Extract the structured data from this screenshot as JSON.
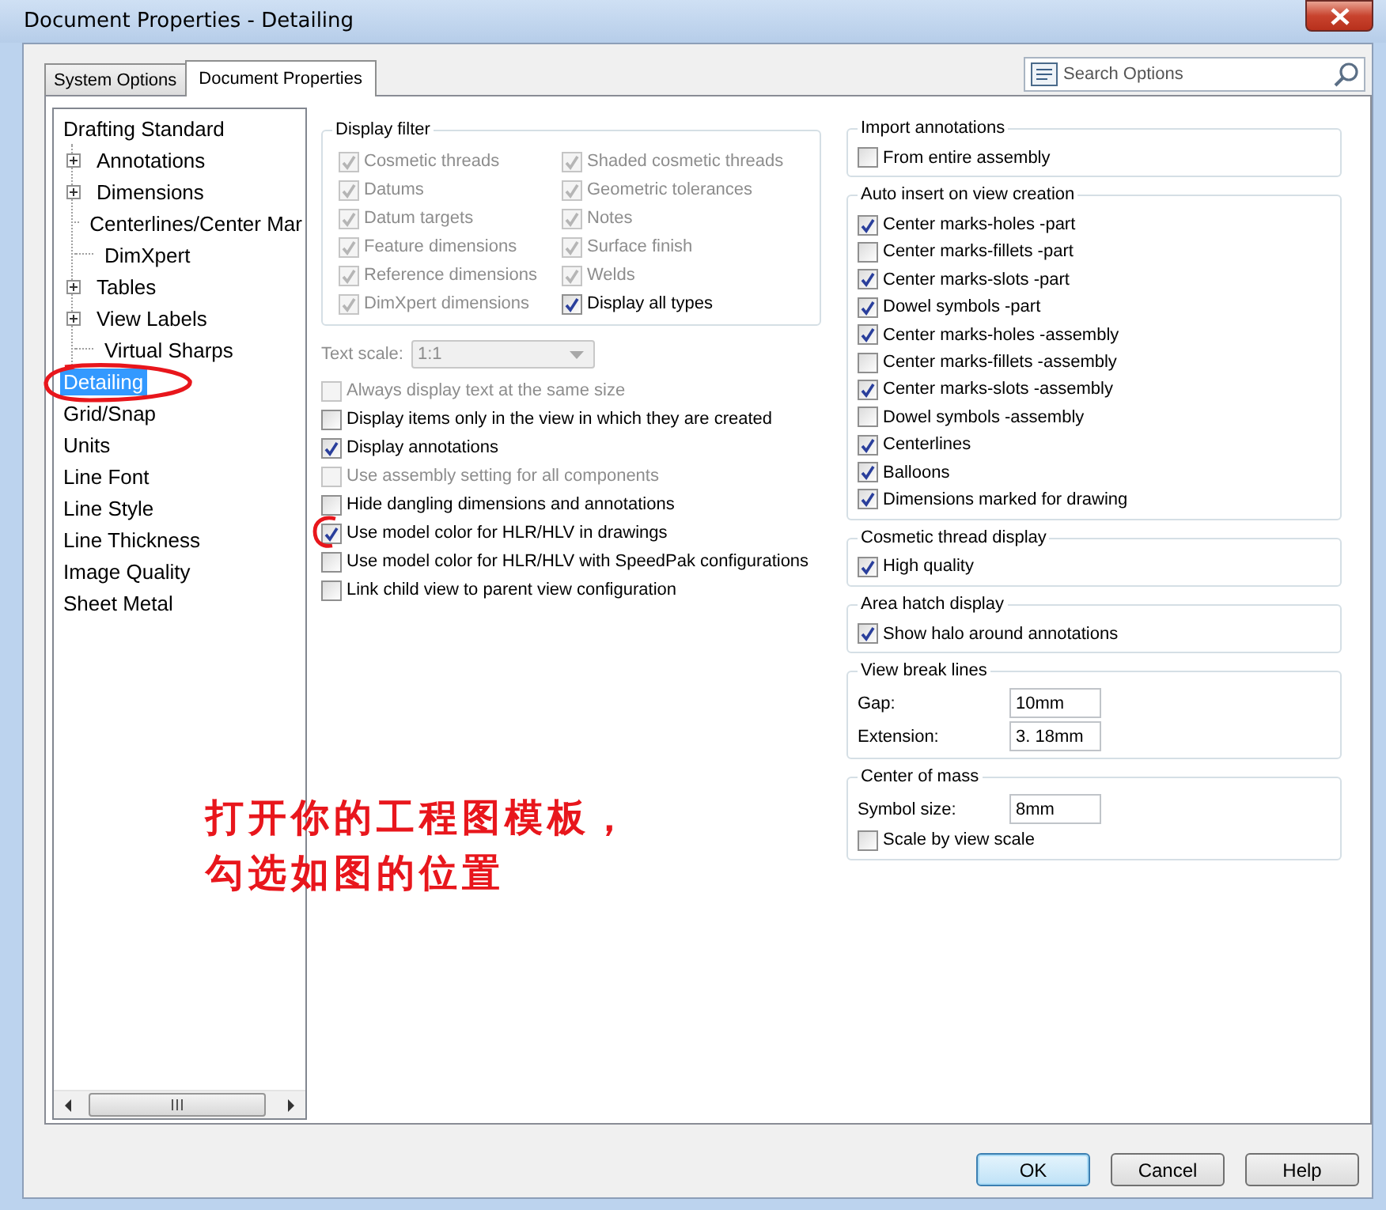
{
  "window": {
    "title": "Document Properties - Detailing"
  },
  "tabs": [
    {
      "label": "System Options",
      "selected": false
    },
    {
      "label": "Document Properties",
      "selected": true
    }
  ],
  "search": {
    "placeholder": "Search Options"
  },
  "tree": [
    {
      "label": "Drafting Standard",
      "selected": false,
      "children": [
        {
          "label": "Annotations",
          "selected": false,
          "kind": "collapsed"
        },
        {
          "label": "Dimensions",
          "selected": false,
          "kind": "collapsed"
        },
        {
          "label": "Centerlines/Center Mar",
          "selected": false,
          "kind": "leaf"
        },
        {
          "label": "DimXpert",
          "selected": false,
          "kind": "leaf"
        },
        {
          "label": "Tables",
          "selected": false,
          "kind": "collapsed"
        },
        {
          "label": "View Labels",
          "selected": false,
          "kind": "collapsed"
        },
        {
          "label": "Virtual Sharps",
          "selected": false,
          "kind": "leaf"
        }
      ]
    },
    {
      "label": "Detailing",
      "selected": true
    },
    {
      "label": "Grid/Snap",
      "selected": false
    },
    {
      "label": "Units",
      "selected": false
    },
    {
      "label": "Line Font",
      "selected": false
    },
    {
      "label": "Line Style",
      "selected": false
    },
    {
      "label": "Line Thickness",
      "selected": false
    },
    {
      "label": "Image Quality",
      "selected": false
    },
    {
      "label": "Sheet Metal",
      "selected": false
    }
  ],
  "display_filter": {
    "title": "Display filter",
    "options": [
      {
        "label": "Cosmetic threads",
        "checked": true,
        "disabled": true
      },
      {
        "label": "Datums",
        "checked": true,
        "disabled": true
      },
      {
        "label": "Datum targets",
        "checked": true,
        "disabled": true
      },
      {
        "label": "Feature dimensions",
        "checked": true,
        "disabled": true
      },
      {
        "label": "Reference dimensions",
        "checked": true,
        "disabled": true
      },
      {
        "label": "DimXpert dimensions",
        "checked": true,
        "disabled": true
      },
      {
        "label": "Shaded cosmetic threads",
        "checked": true,
        "disabled": true
      },
      {
        "label": "Geometric tolerances",
        "checked": true,
        "disabled": true
      },
      {
        "label": "Notes",
        "checked": true,
        "disabled": true
      },
      {
        "label": "Surface finish",
        "checked": true,
        "disabled": true
      },
      {
        "label": "Welds",
        "checked": true,
        "disabled": true
      },
      {
        "label": "Display all types",
        "checked": true,
        "disabled": false
      }
    ]
  },
  "text_scale": {
    "label": "Text scale:",
    "value": "1:1",
    "disabled": true
  },
  "options": [
    {
      "label": "Always display text at the same size",
      "checked": false,
      "disabled": true
    },
    {
      "label": "Display items only in the view in which they are created",
      "checked": false,
      "disabled": false
    },
    {
      "label": "Display annotations",
      "checked": true,
      "disabled": false
    },
    {
      "label": "Use assembly setting for all components",
      "checked": false,
      "disabled": true
    },
    {
      "label": "Hide dangling dimensions and annotations",
      "checked": false,
      "disabled": false
    },
    {
      "label": "Use model color for HLR/HLV in drawings",
      "checked": true,
      "disabled": false
    },
    {
      "label": "Use model color for HLR/HLV with SpeedPak configurations",
      "checked": false,
      "disabled": false
    },
    {
      "label": "Link child view to parent view configuration",
      "checked": false,
      "disabled": false
    }
  ],
  "groups": [
    {
      "title": "Import annotations",
      "options": [
        {
          "label": "From entire assembly",
          "checked": false
        }
      ]
    },
    {
      "title": "Auto insert on view creation",
      "options": [
        {
          "label": "Center marks-holes -part",
          "checked": true
        },
        {
          "label": "Center marks-fillets -part",
          "checked": false
        },
        {
          "label": "Center marks-slots  -part",
          "checked": true
        },
        {
          "label": "Dowel symbols -part",
          "checked": true
        },
        {
          "label": "Center marks-holes -assembly",
          "checked": true
        },
        {
          "label": "Center marks-fillets -assembly",
          "checked": false
        },
        {
          "label": "Center marks-slots  -assembly",
          "checked": true
        },
        {
          "label": "Dowel symbols -assembly",
          "checked": false
        },
        {
          "label": "Centerlines",
          "checked": true
        },
        {
          "label": "Balloons",
          "checked": true
        },
        {
          "label": "Dimensions marked for drawing",
          "checked": true
        }
      ]
    },
    {
      "title": "Cosmetic thread display",
      "options": [
        {
          "label": "High quality",
          "checked": true
        }
      ]
    },
    {
      "title": "Area hatch display",
      "options": [
        {
          "label": "Show halo around annotations",
          "checked": true
        }
      ]
    },
    {
      "title": "View break lines",
      "fields": [
        {
          "label": "Gap:",
          "value": "10mm"
        },
        {
          "label": "Extension:",
          "value": "3. 18mm"
        }
      ]
    },
    {
      "title": "Center of mass",
      "fields": [
        {
          "label": "Symbol size:",
          "value": "8mm"
        }
      ],
      "options": [
        {
          "label": "Scale by view scale",
          "checked": false
        }
      ]
    }
  ],
  "note": {
    "lines": [
      "打开你的工程图模板，",
      "勾选如图的位置"
    ]
  },
  "buttons": [
    {
      "label": "OK",
      "kind": "default"
    },
    {
      "label": "Cancel",
      "kind": "normal"
    },
    {
      "label": "Help",
      "kind": "normal"
    }
  ]
}
